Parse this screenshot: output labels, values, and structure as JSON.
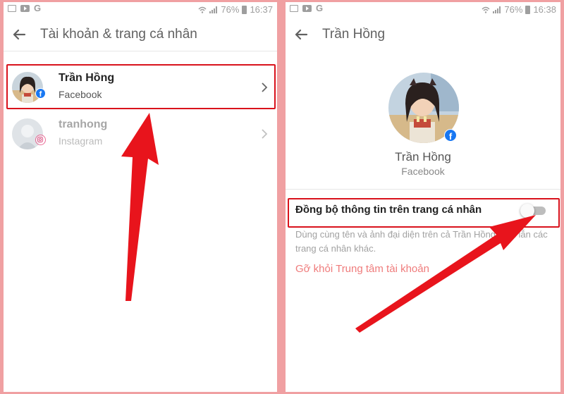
{
  "left_screen": {
    "status": {
      "battery": "76%",
      "time": "16:37"
    },
    "title": "Tài khoản & trang cá nhân",
    "accounts": [
      {
        "name": "Trần Hồng",
        "platform": "Facebook",
        "badge_icon": "facebook-icon"
      },
      {
        "name": "tranhong",
        "platform": "Instagram",
        "badge_icon": "instagram-icon"
      }
    ]
  },
  "right_screen": {
    "status": {
      "battery": "76%",
      "time": "16:38"
    },
    "title": "Trần Hồng",
    "profile": {
      "name": "Trần Hồng",
      "platform": "Facebook"
    },
    "sync": {
      "label": "Đồng bộ thông tin trên trang cá nhân",
      "description": "Dùng cùng tên và ảnh đại diện trên cả Trần Hồng Men lẫn các trang cá nhân khác.",
      "enabled": false
    },
    "remove_link": "Gỡ khỏi Trung tâm tài khoản"
  },
  "colors": {
    "highlight": "#d9121c",
    "arrow": "#e8141c",
    "facebook": "#1877f2",
    "link": "#ef7c7c"
  }
}
